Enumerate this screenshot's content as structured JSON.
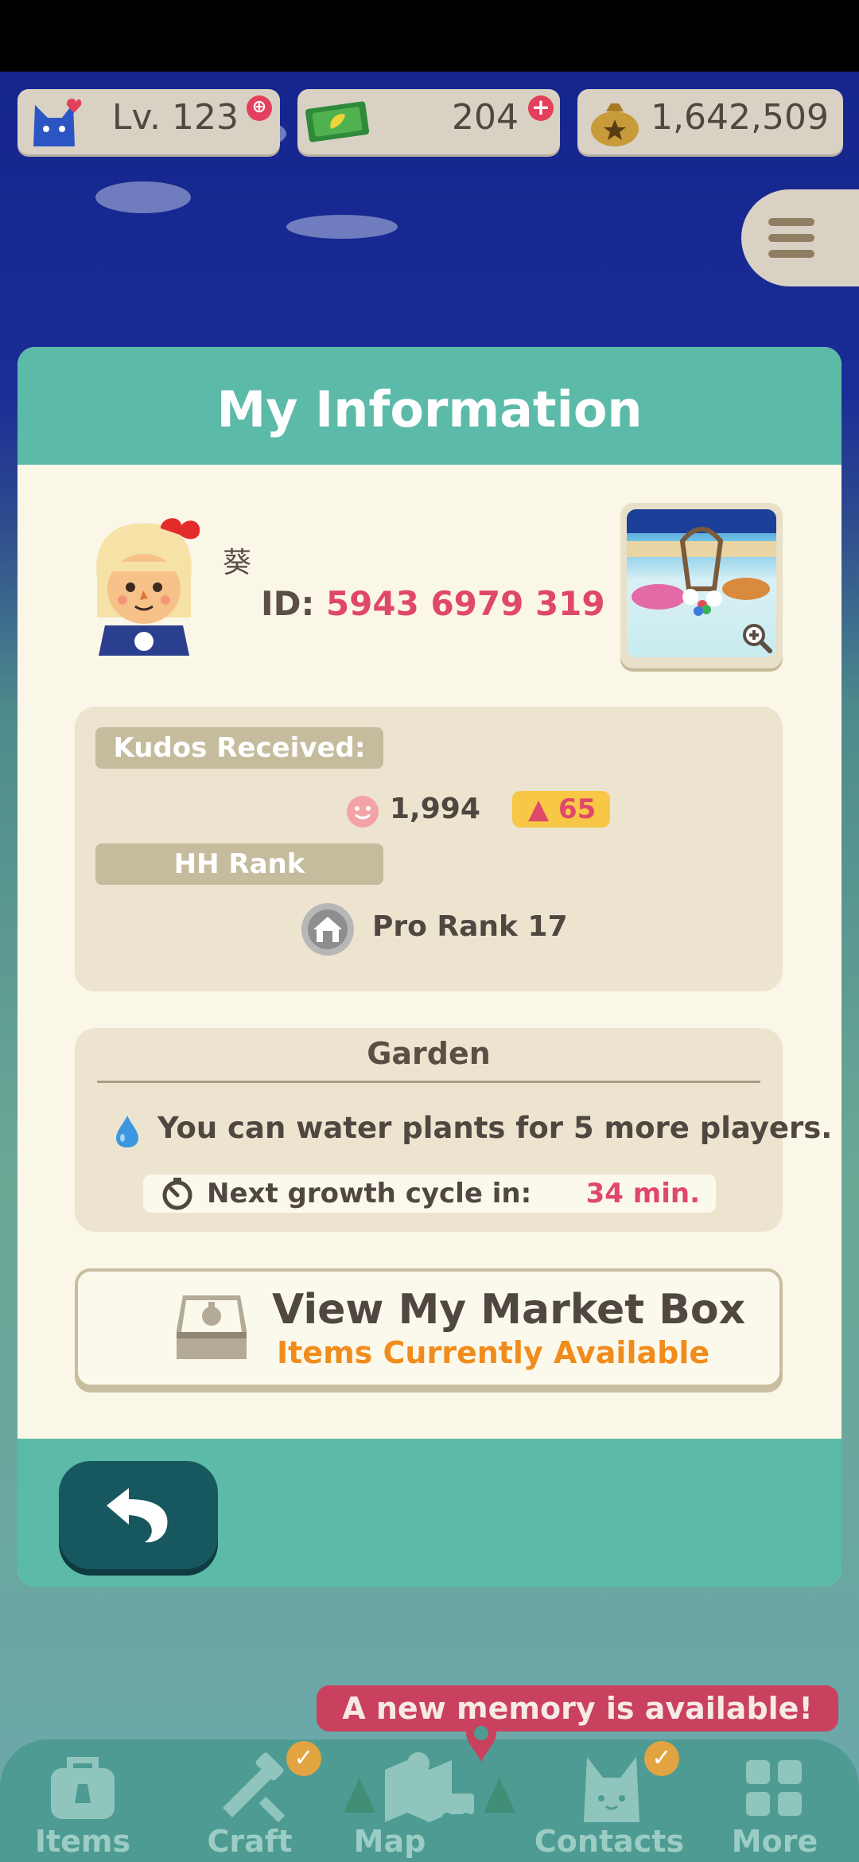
{
  "currency": {
    "level": "Lv. 123",
    "leaf_tickets": "204",
    "bells": "1,642,509"
  },
  "modal": {
    "title": "My Information",
    "player": {
      "name": "葵",
      "id_label": "ID:",
      "id_value": "5943 6979 319"
    },
    "kudos": {
      "label": "Kudos Received:",
      "value": "1,994",
      "delta": "65"
    },
    "rank": {
      "label": "HH Rank",
      "value": "Pro Rank 17"
    },
    "garden": {
      "title": "Garden",
      "water_text": "You can water plants for 5 more players.",
      "cycle_label": "Next growth cycle in:",
      "cycle_value": "34 min."
    },
    "market": {
      "title": "View My Market Box",
      "subtitle": "Items Currently Available"
    }
  },
  "banner": {
    "memory": "A new memory is available!"
  },
  "nav": {
    "items": [
      {
        "label": "Items",
        "icon": "bag-icon"
      },
      {
        "label": "Craft",
        "icon": "hammer-saw-icon"
      },
      {
        "label": "Map",
        "icon": "map-icon"
      },
      {
        "label": "Contacts",
        "icon": "cat-face-icon"
      },
      {
        "label": "More",
        "icon": "grid-icon"
      }
    ]
  },
  "colors": {
    "teal": "#5cbaa8",
    "accent_pink": "#e0486b",
    "accent_orange": "#f08c1c",
    "panel": "#ede4d0"
  }
}
